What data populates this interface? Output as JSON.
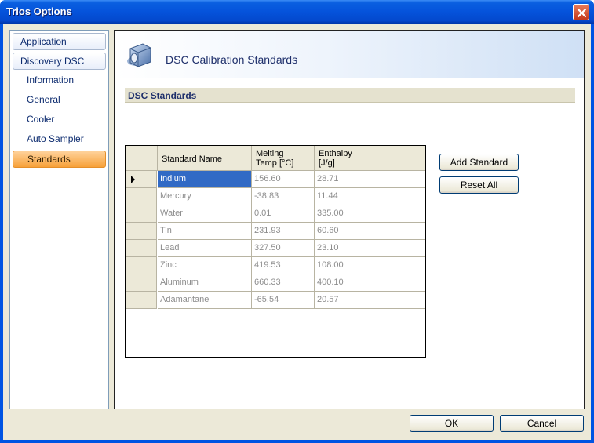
{
  "window": {
    "title": "Trios Options"
  },
  "nav": {
    "items": [
      {
        "label": "Application",
        "kind": "top"
      },
      {
        "label": "Discovery DSC",
        "kind": "top"
      },
      {
        "label": "Information",
        "kind": "sub"
      },
      {
        "label": "General",
        "kind": "sub"
      },
      {
        "label": "Cooler",
        "kind": "sub"
      },
      {
        "label": "Auto Sampler",
        "kind": "sub"
      },
      {
        "label": "Standards",
        "kind": "sub",
        "selected": true
      }
    ]
  },
  "panel": {
    "title": "DSC Calibration Standards",
    "section": "DSC Standards"
  },
  "grid": {
    "columns": [
      "Standard Name",
      "Melting\nTemp [°C]",
      "Enthalpy\n[J/g]"
    ],
    "rows": [
      {
        "name": "Indium",
        "temp": "156.60",
        "enthalpy": "28.71",
        "current": true
      },
      {
        "name": "Mercury",
        "temp": "-38.83",
        "enthalpy": "11.44"
      },
      {
        "name": "Water",
        "temp": "0.01",
        "enthalpy": "335.00"
      },
      {
        "name": "Tin",
        "temp": "231.93",
        "enthalpy": "60.60"
      },
      {
        "name": "Lead",
        "temp": "327.50",
        "enthalpy": "23.10"
      },
      {
        "name": "Zinc",
        "temp": "419.53",
        "enthalpy": "108.00"
      },
      {
        "name": "Aluminum",
        "temp": "660.33",
        "enthalpy": "400.10"
      },
      {
        "name": "Adamantane",
        "temp": "-65.54",
        "enthalpy": "20.57"
      }
    ]
  },
  "buttons": {
    "add_standard": "Add Standard",
    "reset_all": "Reset All",
    "ok": "OK",
    "cancel": "Cancel"
  },
  "colors": {
    "titlebar": "#0553db",
    "selection": "#316ac5",
    "nav_selected": "#f7a13a"
  }
}
